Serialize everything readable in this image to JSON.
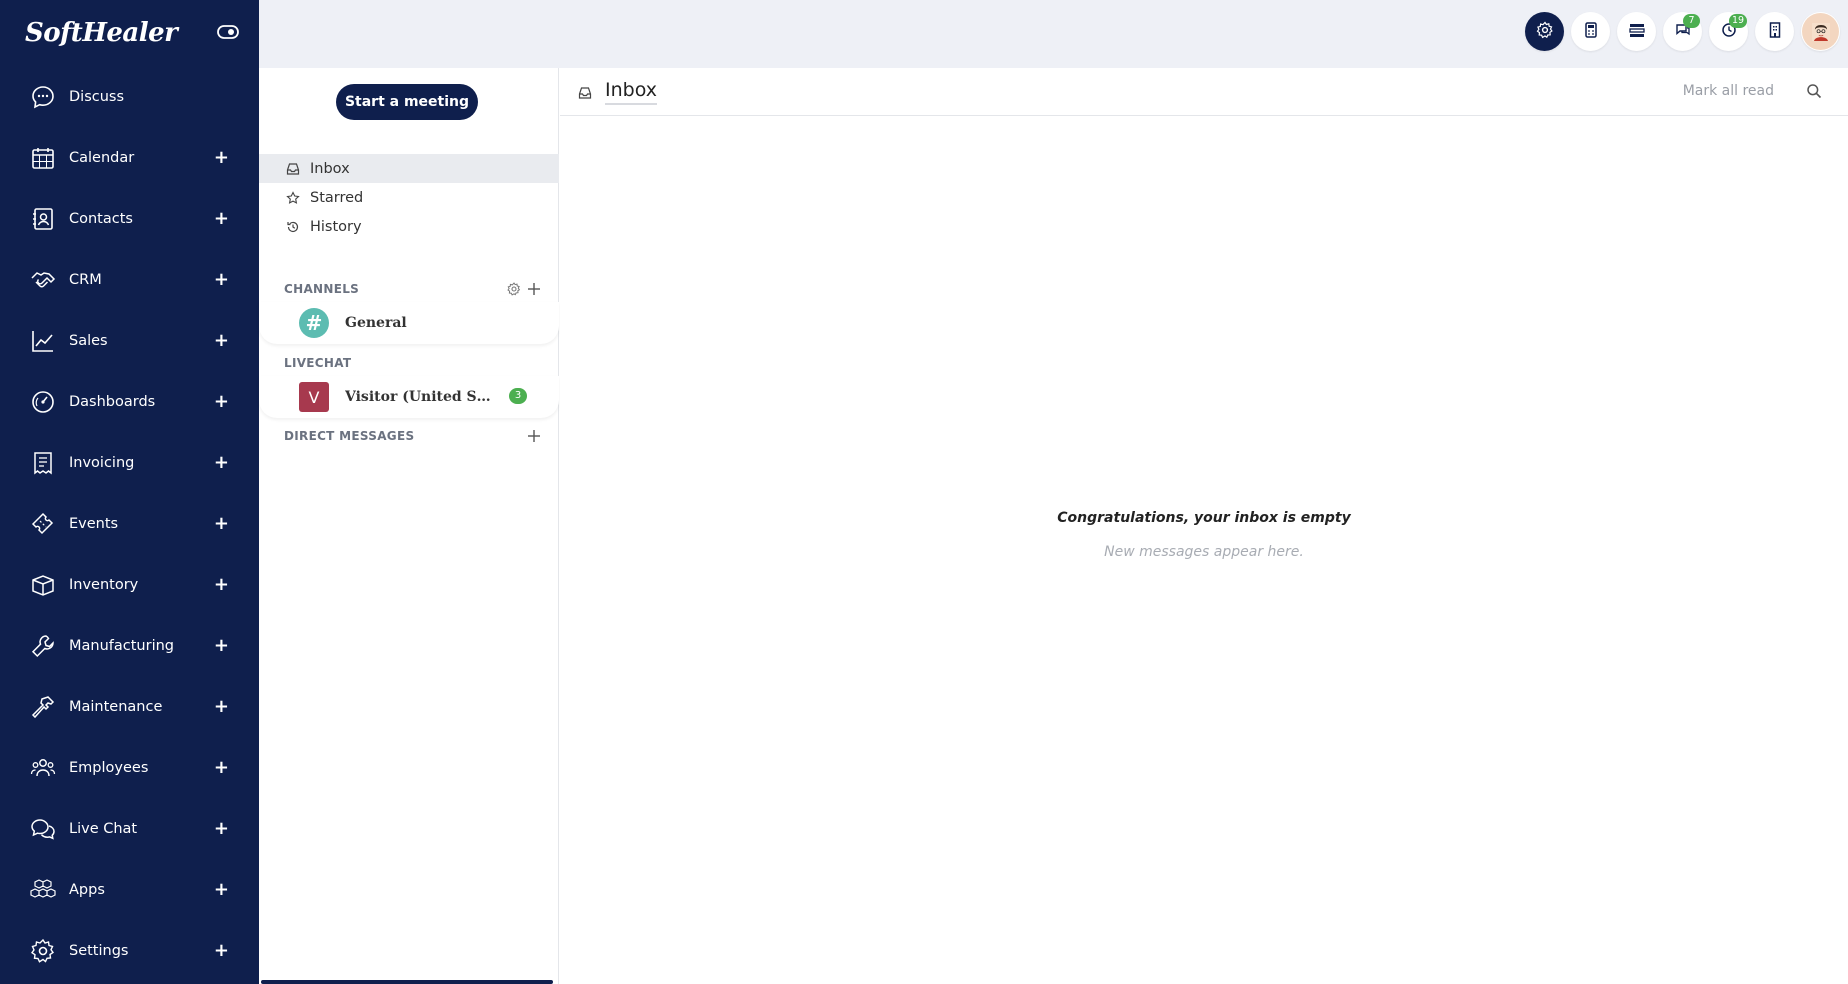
{
  "app": {
    "brand": "SoftHealer"
  },
  "sidebar": {
    "items": [
      {
        "label": "Discuss",
        "icon": "chat-bubble-icon",
        "has_plus": false
      },
      {
        "label": "Calendar",
        "icon": "calendar-icon",
        "has_plus": true
      },
      {
        "label": "Contacts",
        "icon": "contact-card-icon",
        "has_plus": true
      },
      {
        "label": "CRM",
        "icon": "handshake-icon",
        "has_plus": true
      },
      {
        "label": "Sales",
        "icon": "trend-chart-icon",
        "has_plus": true
      },
      {
        "label": "Dashboards",
        "icon": "gauge-icon",
        "has_plus": true
      },
      {
        "label": "Invoicing",
        "icon": "receipt-icon",
        "has_plus": true
      },
      {
        "label": "Events",
        "icon": "ticket-icon",
        "has_plus": true
      },
      {
        "label": "Inventory",
        "icon": "box-icon",
        "has_plus": true
      },
      {
        "label": "Manufacturing",
        "icon": "wrench-icon",
        "has_plus": true
      },
      {
        "label": "Maintenance",
        "icon": "hammer-icon",
        "has_plus": true
      },
      {
        "label": "Employees",
        "icon": "people-icon",
        "has_plus": true
      },
      {
        "label": "Live Chat",
        "icon": "chat-bubbles-icon",
        "has_plus": true
      },
      {
        "label": "Apps",
        "icon": "cubes-icon",
        "has_plus": true
      },
      {
        "label": "Settings",
        "icon": "gear-icon",
        "has_plus": true
      }
    ],
    "plus_symbol": "+"
  },
  "topbar": {
    "buttons": [
      {
        "name": "settings",
        "icon": "gear-icon",
        "badge": ""
      },
      {
        "name": "calculator",
        "icon": "calculator-icon",
        "badge": ""
      },
      {
        "name": "layout",
        "icon": "layout-icon",
        "badge": ""
      },
      {
        "name": "messages",
        "icon": "chat-icon",
        "badge": "7"
      },
      {
        "name": "activities",
        "icon": "clock-icon",
        "badge": "19"
      },
      {
        "name": "company",
        "icon": "building-icon",
        "badge": ""
      }
    ]
  },
  "mail": {
    "start_meeting": "Start a meeting",
    "mailboxes": [
      {
        "label": "Inbox",
        "icon": "inbox-icon",
        "active": true
      },
      {
        "label": "Starred",
        "icon": "star-icon",
        "active": false
      },
      {
        "label": "History",
        "icon": "history-icon",
        "active": false
      }
    ],
    "channels": {
      "title": "CHANNELS",
      "items": [
        {
          "name": "General",
          "avatar": "#"
        }
      ]
    },
    "livechat": {
      "title": "LIVECHAT",
      "items": [
        {
          "name": "Visitor (United Stat...",
          "avatar": "V",
          "counter": "3"
        }
      ]
    },
    "direct_messages": {
      "title": "DIRECT MESSAGES"
    }
  },
  "main": {
    "title": "Inbox",
    "mark_all_read": "Mark all read",
    "empty_title": "Congratulations, your inbox is empty",
    "empty_sub": "New messages appear here."
  },
  "colors": {
    "sidebar_bg": "#0f1f4d",
    "topbar_bg": "#eef0f6",
    "badge_green": "#4caf50",
    "channel_avatar": "#5cbcb1",
    "visitor_avatar": "#a7394e"
  }
}
